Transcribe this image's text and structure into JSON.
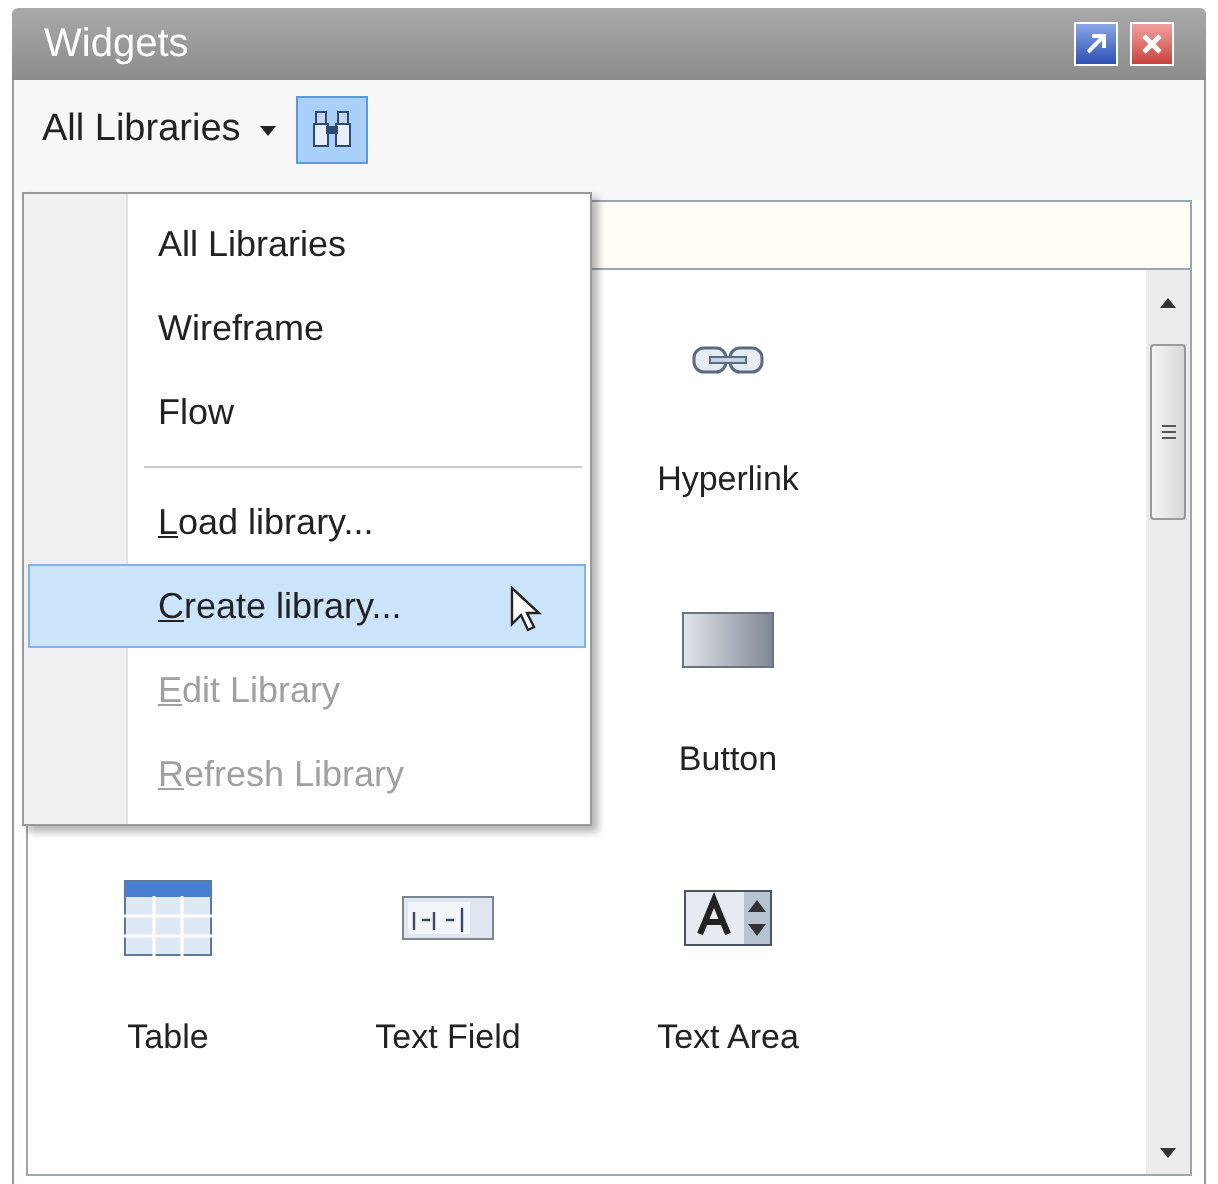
{
  "window": {
    "title": "Widgets"
  },
  "toolbar": {
    "library_combo": "All Libraries",
    "search_button_selected": true
  },
  "menu": {
    "items": [
      {
        "kind": "item",
        "label": "All Libraries",
        "selected": false,
        "disabled": false,
        "underline_first": false
      },
      {
        "kind": "item",
        "label": "Wireframe",
        "selected": false,
        "disabled": false,
        "underline_first": false
      },
      {
        "kind": "item",
        "label": "Flow",
        "selected": false,
        "disabled": false,
        "underline_first": false
      },
      {
        "kind": "separator"
      },
      {
        "kind": "item",
        "label": "Load library...",
        "selected": false,
        "disabled": false,
        "underline_first": true
      },
      {
        "kind": "item",
        "label": "Create library...",
        "selected": true,
        "disabled": false,
        "underline_first": true
      },
      {
        "kind": "item",
        "label": "Edit Library",
        "selected": false,
        "disabled": true,
        "underline_first": true
      },
      {
        "kind": "item",
        "label": "Refresh Library",
        "selected": false,
        "disabled": true,
        "underline_first": true
      }
    ]
  },
  "widget_rows": [
    [
      {
        "kind": "hyperlink",
        "label": "Hyperlink"
      }
    ],
    [
      {
        "kind": "button",
        "label": "Button"
      }
    ],
    [
      {
        "kind": "table",
        "label": "Table"
      },
      {
        "kind": "text_field",
        "label": "Text Field"
      },
      {
        "kind": "text_area",
        "label": "Text Area"
      }
    ]
  ]
}
